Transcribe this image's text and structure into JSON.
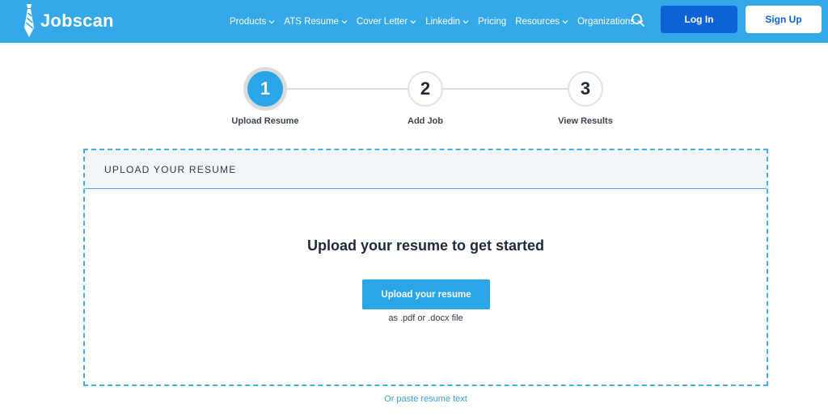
{
  "brand": {
    "name": "Jobscan",
    "logo_icon": "tie-icon"
  },
  "nav": {
    "items": [
      {
        "label": "Products",
        "has_dropdown": true
      },
      {
        "label": "ATS Resume",
        "has_dropdown": true
      },
      {
        "label": "Cover Letter",
        "has_dropdown": true
      },
      {
        "label": "Linkedin",
        "has_dropdown": true
      },
      {
        "label": "Pricing",
        "has_dropdown": false
      },
      {
        "label": "Resources",
        "has_dropdown": true
      },
      {
        "label": "Organizations",
        "has_dropdown": true
      }
    ],
    "search_icon": "search-icon",
    "login_label": "Log In",
    "signup_label": "Sign Up"
  },
  "stepper": {
    "steps": [
      {
        "number": "1",
        "label": "Upload Resume",
        "active": true
      },
      {
        "number": "2",
        "label": "Add Job",
        "active": false
      },
      {
        "number": "3",
        "label": "View Results",
        "active": false
      }
    ]
  },
  "upload": {
    "section_title": "UPLOAD YOUR RESUME",
    "heading": "Upload your resume to get started",
    "button_label": "Upload your resume",
    "hint": "as .pdf or .docx file",
    "paste_link": "Or paste resume text"
  },
  "colors": {
    "header_bg": "#35a9e8",
    "primary_button": "#0b63d6",
    "accent": "#2aa6e8"
  }
}
